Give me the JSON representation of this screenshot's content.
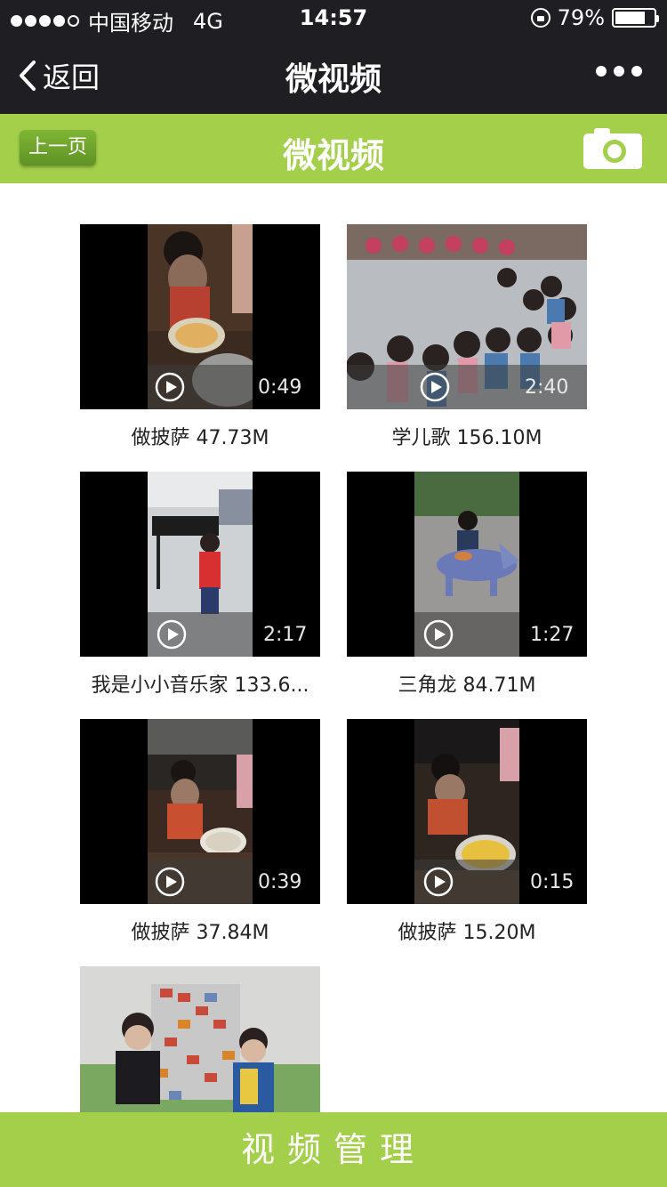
{
  "status_bar": {
    "carrier": "中国移动",
    "network": "4G",
    "time": "14:57",
    "battery": "79%",
    "battery_level": 0.79
  },
  "nav": {
    "back_label": "返回",
    "title": "微视频"
  },
  "header": {
    "prev_label": "上一页",
    "title": "微视频",
    "camera_icon": "camera-icon"
  },
  "videos": [
    {
      "caption": "做披萨 47.73M",
      "duration": "0:49"
    },
    {
      "caption": "学儿歌 156.10M",
      "duration": "2:40"
    },
    {
      "caption": "我是小小音乐家 133.6...",
      "duration": "2:17"
    },
    {
      "caption": "三角龙 84.71M",
      "duration": "1:27"
    },
    {
      "caption": "做披萨 37.84M",
      "duration": "0:39"
    },
    {
      "caption": "做披萨 15.20M",
      "duration": "0:15"
    },
    {
      "caption": "",
      "duration": ""
    }
  ],
  "footer": {
    "manage_label": "视频管理"
  },
  "colors": {
    "accent_green": "#a4cf4a",
    "topbar_dark": "#1f1e23"
  }
}
